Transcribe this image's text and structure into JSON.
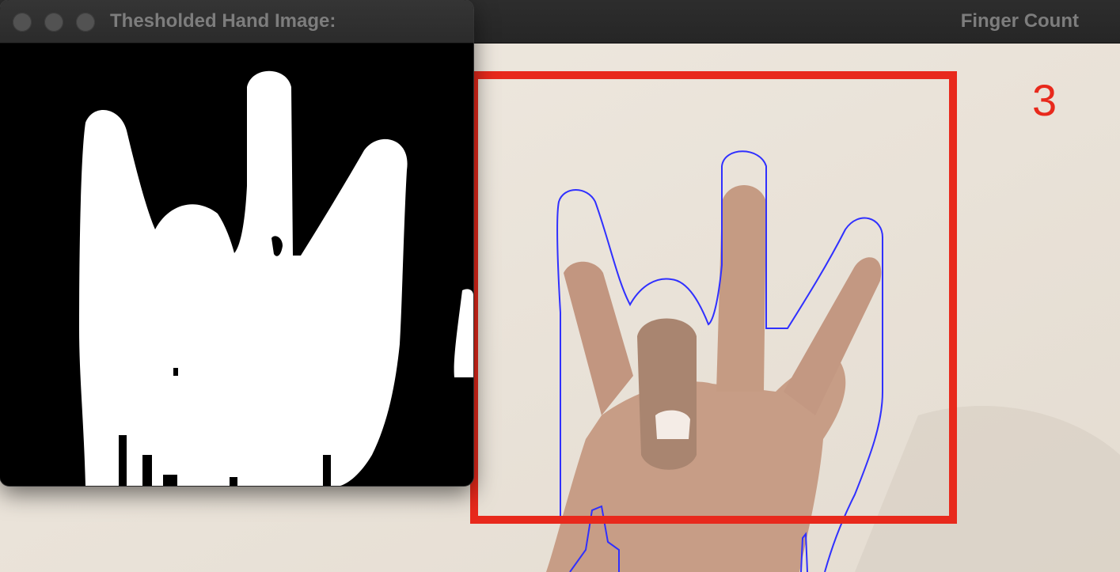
{
  "back_window": {
    "title": "Finger Count",
    "finger_count": "3"
  },
  "front_window": {
    "title": "Thesholded Hand Image:"
  },
  "colors": {
    "bounding_box": "#e8291c",
    "contour": "#3030ff",
    "count_text": "#e8291c",
    "wall": "#ede6dc",
    "skin": "#c59a82",
    "mask_foreground": "#ffffff",
    "mask_background": "#000000"
  }
}
